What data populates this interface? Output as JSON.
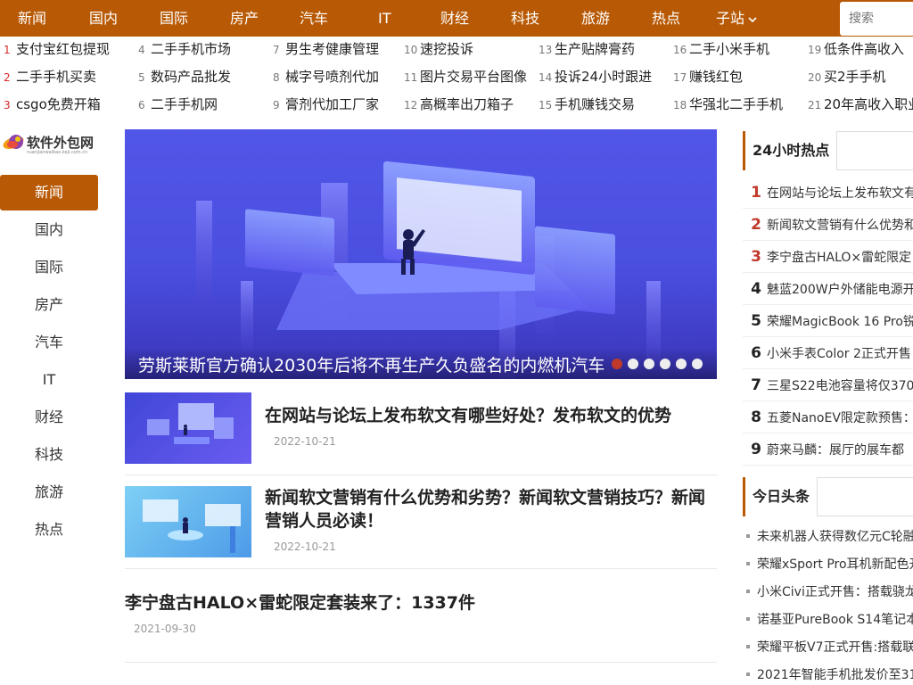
{
  "topnav": {
    "items": [
      "新闻",
      "国内",
      "国际",
      "房产",
      "汽车",
      "IT",
      "财经",
      "科技",
      "旅游",
      "热点"
    ],
    "subsite_label": "子站",
    "search_placeholder": "搜索"
  },
  "keywords": [
    {
      "num": "1",
      "text": "支付宝红包提现"
    },
    {
      "num": "2",
      "text": "二手手机买卖"
    },
    {
      "num": "3",
      "text": "csgo免费开箱"
    },
    {
      "num": "4",
      "text": "二手手机市场"
    },
    {
      "num": "5",
      "text": "数码产品批发"
    },
    {
      "num": "6",
      "text": "二手手机网"
    },
    {
      "num": "7",
      "text": "男生考健康管理"
    },
    {
      "num": "8",
      "text": "械字号喷剂代加"
    },
    {
      "num": "9",
      "text": "膏剂代加工厂家"
    },
    {
      "num": "10",
      "text": "速挖投诉"
    },
    {
      "num": "11",
      "text": "图片交易平台图像"
    },
    {
      "num": "12",
      "text": "高概率出刀箱子"
    },
    {
      "num": "13",
      "text": "生产贴牌膏药"
    },
    {
      "num": "14",
      "text": "投诉24小时跟进"
    },
    {
      "num": "15",
      "text": "手机赚钱交易"
    },
    {
      "num": "16",
      "text": "二手小米手机"
    },
    {
      "num": "17",
      "text": "赚钱红包"
    },
    {
      "num": "18",
      "text": "华强北二手手机"
    },
    {
      "num": "19",
      "text": "低条件高收入"
    },
    {
      "num": "20",
      "text": "买2手手机"
    },
    {
      "num": "21",
      "text": "20年高收入职业"
    }
  ],
  "logo": {
    "text": "软件外包网",
    "sub": "ruanjianwaibao.keji.com.cn"
  },
  "leftnav": {
    "items": [
      "新闻",
      "国内",
      "国际",
      "房产",
      "汽车",
      "IT",
      "财经",
      "科技",
      "旅游",
      "热点"
    ],
    "active": "新闻"
  },
  "banner": {
    "caption": "劳斯莱斯官方确认2030年后将不再生产久负盛名的内燃机汽车",
    "slide_count": 6,
    "active_slide": 1
  },
  "articles": [
    {
      "title": "在网站与论坛上发布软文有哪些好处？发布软文的优势",
      "date": "2022-10-21"
    },
    {
      "title": "新闻软文营销有什么优势和劣势？新闻软文营销技巧？新闻营销人员必读！",
      "date": "2022-10-21"
    },
    {
      "title": "李宁盘古HALO×雷蛇限定套装来了：1337件",
      "date": "2021-09-30"
    }
  ],
  "hot24": {
    "title": "24小时热点",
    "items": [
      {
        "num": "1",
        "text": "在网站与论坛上发布软文有"
      },
      {
        "num": "2",
        "text": "新闻软文营销有什么优势和"
      },
      {
        "num": "3",
        "text": "李宁盘古HALO×雷蛇限定"
      },
      {
        "num": "4",
        "text": "魅蓝200W户外储能电源开"
      },
      {
        "num": "5",
        "text": "荣耀MagicBook 16 Pro锐"
      },
      {
        "num": "6",
        "text": "小米手表Color 2正式开售"
      },
      {
        "num": "7",
        "text": "三星S22电池容量将仅370"
      },
      {
        "num": "8",
        "text": "五菱NanoEV限定款预售："
      },
      {
        "num": "9",
        "text": "蔚来马麟：展厅的展车都"
      }
    ]
  },
  "headlines": {
    "title": "今日头条",
    "items": [
      "未来机器人获得数亿元C轮融",
      "荣耀xSport Pro耳机新配色开",
      "小米Civi正式开售：搭载骁龙",
      "诺基亚PureBook S14笔记本",
      "荣耀平板V7正式开售:搭载联",
      "2021年智能手机批发价至31"
    ]
  },
  "colors": {
    "brand": "#b85a05",
    "rank_red": "#c0392b"
  }
}
